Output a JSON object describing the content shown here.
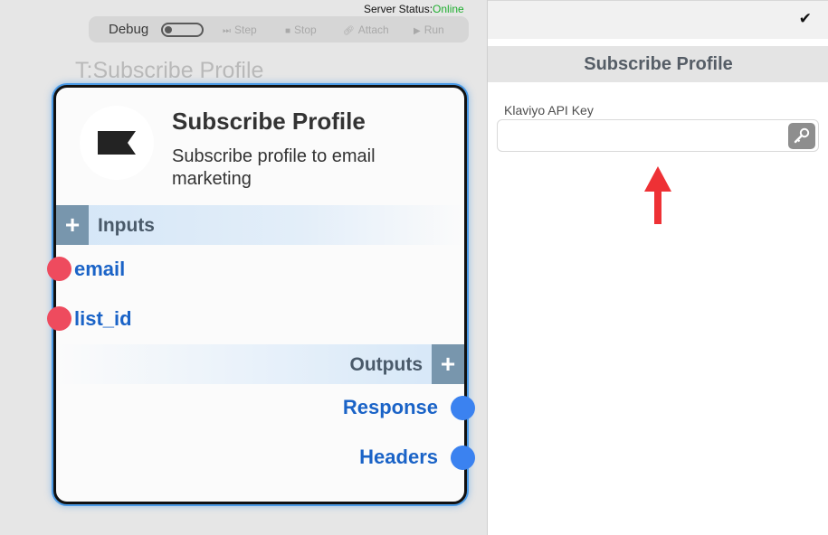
{
  "server": {
    "label": "Server Status:",
    "status": "Online",
    "status_color": "#1fae2f"
  },
  "toolbar": {
    "debug_label": "Debug",
    "debug_enabled": false,
    "step_label": "Step",
    "stop_label": "Stop",
    "attach_label": "Attach",
    "run_label": "Run"
  },
  "canvas": {
    "node_heading": "T:Subscribe Profile"
  },
  "node": {
    "title": "Subscribe Profile",
    "description": "Subscribe profile to email marketing",
    "inputs_label": "Inputs",
    "outputs_label": "Outputs",
    "inputs": [
      {
        "label": "email"
      },
      {
        "label": "list_id"
      }
    ],
    "outputs": [
      {
        "label": "Response"
      },
      {
        "label": "Headers"
      }
    ],
    "input_port_color": "#ee4b5e",
    "output_port_color": "#3b82f0",
    "logo_icon": "klaviyo-flag-icon"
  },
  "panel": {
    "header": "Subscribe Profile",
    "api_key_label": "Klaviyo API Key",
    "api_key_value": "",
    "api_key_placeholder": "",
    "check_icon": "checkmark-icon",
    "key_icon": "key-icon",
    "annotation_icon": "red-up-arrow-icon"
  }
}
